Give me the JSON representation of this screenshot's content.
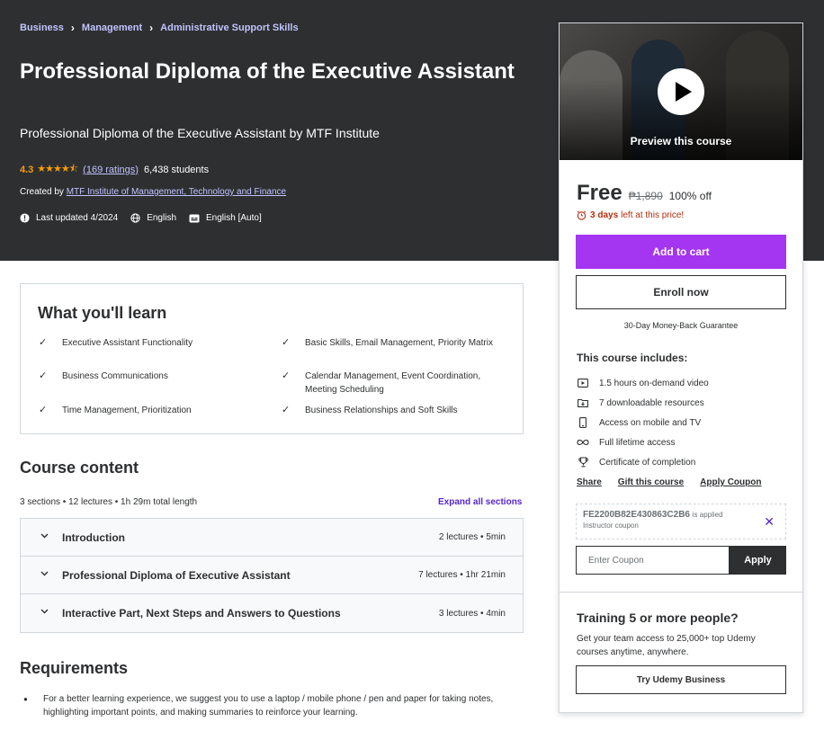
{
  "breadcrumb": [
    "Business",
    "Management",
    "Administrative Support Skills"
  ],
  "course": {
    "title": "Professional Diploma of the Executive Assistant",
    "subtitle": "Professional Diploma of the Executive Assistant by MTF Institute",
    "rating": "4.3",
    "ratings_count": "(169 ratings)",
    "students": "6,438 students",
    "created_by_label": "Created by",
    "instructor": "MTF Institute of Management, Technology and Finance",
    "last_updated": "Last updated 4/2024",
    "language": "English",
    "captions": "English [Auto]"
  },
  "sidebar": {
    "preview_label": "Preview this course",
    "price": "Free",
    "original_price": "₱1,890",
    "discount": "100% off",
    "days_left_bold": "3 days",
    "days_left_rest": "left at this price!",
    "add_to_cart": "Add to cart",
    "enroll_now": "Enroll now",
    "guarantee": "30-Day Money-Back Guarantee",
    "includes_title": "This course includes:",
    "includes": [
      {
        "icon": "video-icon",
        "label": "1.5 hours on-demand video"
      },
      {
        "icon": "download-icon",
        "label": "7 downloadable resources"
      },
      {
        "icon": "mobile-icon",
        "label": "Access on mobile and TV"
      },
      {
        "icon": "infinity-icon",
        "label": "Full lifetime access"
      },
      {
        "icon": "trophy-icon",
        "label": "Certificate of completion"
      }
    ],
    "links": [
      "Share",
      "Gift this course",
      "Apply Coupon"
    ],
    "coupon_code": "FE2200B82E430863C2B6",
    "coupon_applied": "is applied",
    "coupon_sub": "Instructor coupon",
    "coupon_placeholder": "Enter Coupon",
    "coupon_apply": "Apply",
    "training_title": "Training 5 or more people?",
    "training_text": "Get your team access to 25,000+ top Udemy courses anytime, anywhere.",
    "business_button": "Try Udemy Business"
  },
  "learn": {
    "title": "What you'll learn",
    "items": [
      "Executive Assistant Functionality",
      "Basic Skills, Email Management, Priority Matrix",
      "Business Communications",
      "Calendar Management, Event Coordination, Meeting Scheduling",
      "Time Management, Prioritization",
      "Business Relationships and Soft Skills"
    ]
  },
  "content": {
    "title": "Course content",
    "meta": "3 sections • 12 lectures • 1h 29m total length",
    "expand": "Expand all sections",
    "sections": [
      {
        "title": "Introduction",
        "info": "2 lectures • 5min"
      },
      {
        "title": "Professional Diploma of Executive Assistant",
        "info": "7 lectures • 1hr 21min"
      },
      {
        "title": "Interactive Part, Next Steps and Answers to Questions",
        "info": "3 lectures • 4min"
      }
    ]
  },
  "requirements": {
    "title": "Requirements",
    "items": [
      "For a better learning experience, we suggest you to use a laptop / mobile phone / pen and paper for taking notes, highlighting important points, and making summaries to reinforce your learning."
    ]
  },
  "colors": {
    "hero_bg": "#2d2f31",
    "accent_purple": "#a435f0",
    "link_purple": "#5624d0",
    "breadcrumb_lavender": "#c0c4fc",
    "star_orange": "#f69c08",
    "alert_red": "#b32d0f"
  }
}
